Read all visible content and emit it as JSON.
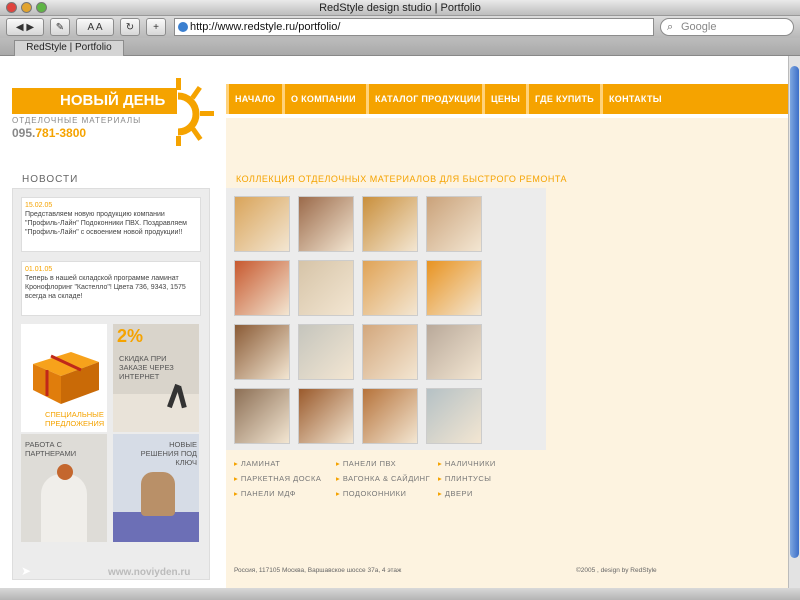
{
  "window": {
    "title": "RedStyle design studio | Portfolio"
  },
  "toolbar": {
    "url": "http://www.redstyle.ru/portfolio/",
    "search_placeholder": "Google"
  },
  "tab": {
    "label": "RedStyle | Portfolio"
  },
  "logo": {
    "name": "НОВЫЙ ДЕНЬ",
    "subtitle": "ОТДЕЛОЧНЫЕ МАТЕРИАЛЫ",
    "phone_prefix": "095.",
    "phone_main": "781-3800"
  },
  "nav": [
    "НАЧАЛО",
    "О КОМПАНИИ",
    "КАТАЛОГ ПРОДУКЦИИ",
    "ЦЕНЫ",
    "ГДЕ КУПИТЬ",
    "КОНТАКТЫ"
  ],
  "news": {
    "heading": "НОВОСТИ",
    "items": [
      {
        "date": "15.02.05",
        "text": "Представляем новую продукцию компании \"Профиль-Лайн\" Подоконники ПВХ. Поздравляем \"Профиль-Лайн\" с освоением новой продукции!!"
      },
      {
        "date": "01.01.05",
        "text": "Теперь в нашей складской программе ламинат Кронофлоринг \"Кастелло\"! Цвета 736, 9343, 1575 всегда на складе!"
      }
    ]
  },
  "promos": {
    "special": "СПЕЦИАЛЬНЫЕ ПРЕДЛОЖЕНИЯ",
    "discount_pct": "2%",
    "discount": "СКИДКА ПРИ ЗАКАЗЕ ЧЕРЕЗ ИНТЕРНЕТ",
    "partners": "РАБОТА С ПАРТНЕРАМИ",
    "turnkey": "НОВЫЕ РЕШЕНИЯ ПОД КЛЮЧ"
  },
  "site_link": "www.noviyden.ru",
  "collection": {
    "heading": "КОЛЛЕКЦИЯ ОТДЕЛОЧНЫХ МАТЕРИАЛОВ ДЛЯ БЫСТРОГО РЕМОНТА"
  },
  "gallery": [
    {
      "name": "floor-tape-photo",
      "color": "#d9a45a"
    },
    {
      "name": "legs-photo",
      "color": "#9b6a4a"
    },
    {
      "name": "white-cat-photo",
      "color": "#c98f3c"
    },
    {
      "name": "stools-photo",
      "color": "#caa27a"
    },
    {
      "name": "slippers-photo",
      "color": "#c7592f"
    },
    {
      "name": "lying-woman-photo",
      "color": "#d6c4a8"
    },
    {
      "name": "candles-photo",
      "color": "#e0a356"
    },
    {
      "name": "orange-chair-photo",
      "color": "#e89321"
    },
    {
      "name": "guitar-photo",
      "color": "#8a5b36"
    },
    {
      "name": "empty-room-photo",
      "color": "#c5c5bd"
    },
    {
      "name": "rocking-horse-photo",
      "color": "#d3a77c"
    },
    {
      "name": "walking-couple-photo",
      "color": "#b9a99a"
    },
    {
      "name": "dancer-photo",
      "color": "#8c6f55"
    },
    {
      "name": "carrots-photo",
      "color": "#9a5a2c"
    },
    {
      "name": "red-ball-photo",
      "color": "#b6733b"
    },
    {
      "name": "heels-photo",
      "color": "#b5c1c5"
    }
  ],
  "categories": [
    [
      "ЛАМИНАТ",
      "ПАРКЕТНАЯ ДОСКА",
      "ПАНЕЛИ МДФ"
    ],
    [
      "ПАНЕЛИ ПВХ",
      "ВАГОНКА & САЙДИНГ",
      "ПОДОКОННИКИ"
    ],
    [
      "НАЛИЧНИКИ",
      "ПЛИНТУСЫ",
      "ДВЕРИ"
    ]
  ],
  "footer": {
    "address": "Россия, 117105 Москва, Варшавское шоссе 37а, 4 этаж",
    "credit": "©2005 , design by RedStyle"
  },
  "colors": {
    "accent": "#f5a300",
    "cream": "#fdf3e0",
    "panel": "#ececec"
  }
}
